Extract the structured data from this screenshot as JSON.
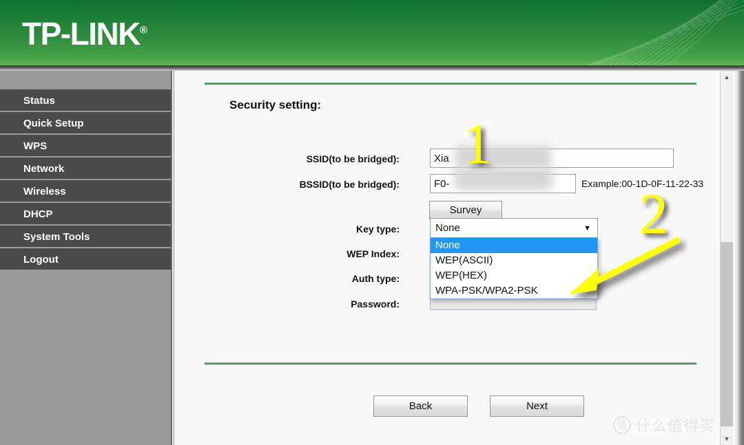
{
  "header": {
    "brand": "TP-LINK",
    "brand_registered": "®",
    "brand_color": "#2e8b3d"
  },
  "sidebar": {
    "items": [
      {
        "label": "Status"
      },
      {
        "label": "Quick Setup"
      },
      {
        "label": "WPS"
      },
      {
        "label": "Network"
      },
      {
        "label": "Wireless"
      },
      {
        "label": "DHCP"
      },
      {
        "label": "System Tools"
      },
      {
        "label": "Logout"
      }
    ]
  },
  "main": {
    "section_title": "Security setting:",
    "fields": {
      "ssid": {
        "label": "SSID(to be bridged):",
        "value": "Xia"
      },
      "bssid": {
        "label": "BSSID(to be bridged):",
        "value": "F0-",
        "hint": "Example:00-1D-0F-11-22-33"
      },
      "key_type": {
        "label": "Key type:",
        "value": "None"
      },
      "wep_index": {
        "label": "WEP Index:"
      },
      "auth_type": {
        "label": "Auth type:"
      },
      "password": {
        "label": "Password:",
        "value": ""
      }
    },
    "survey_button": "Survey",
    "key_type_options": [
      {
        "label": "None",
        "selected": true
      },
      {
        "label": "WEP(ASCII)",
        "selected": false
      },
      {
        "label": "WEP(HEX)",
        "selected": false
      },
      {
        "label": "WPA-PSK/WPA2-PSK",
        "selected": false
      }
    ],
    "buttons": {
      "back": "Back",
      "next": "Next"
    }
  },
  "annotations": {
    "marker_one": "1",
    "marker_two": "2",
    "accent_color": "#ffff00"
  },
  "watermark": {
    "logo_char": "值",
    "text": "什么值得买"
  },
  "select_arrow_glyph": "▼",
  "scrollbar": {
    "up_glyph": "▲",
    "down_glyph": "▼"
  }
}
